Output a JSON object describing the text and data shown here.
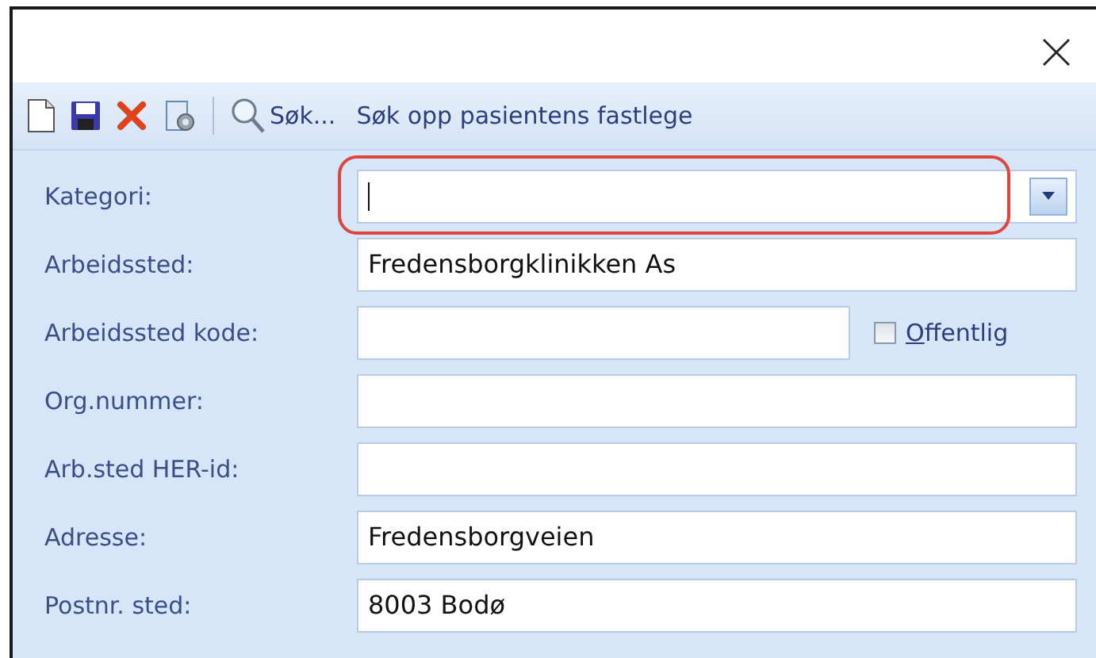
{
  "toolbar": {
    "search_label": "Søk...",
    "lookup_label": "Søk opp pasientens fastlege"
  },
  "fields": [
    {
      "kind": "combo",
      "label": "Kategori:",
      "focused": true,
      "highlighted": true
    },
    {
      "kind": "text",
      "label": "Arbeidssted:",
      "value": "Fredensborgklinikken As"
    },
    {
      "kind": "text_with_checkbox",
      "label": "Arbeidssted kode:",
      "checkbox": {
        "label_first": "O",
        "label_rest": "ffentlig",
        "checked": false
      }
    },
    {
      "kind": "text",
      "label": "Org.nummer:"
    },
    {
      "kind": "text",
      "label": "Arb.sted HER-id:"
    },
    {
      "kind": "text",
      "label": "Adresse:",
      "value": "Fredensborgveien"
    },
    {
      "kind": "text",
      "label": "Postnr. sted:",
      "value": "8003 Bodø"
    }
  ]
}
